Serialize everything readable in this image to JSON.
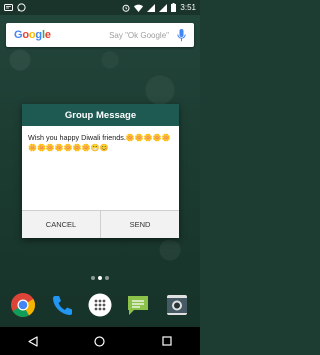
{
  "status_bar": {
    "time": "3:51",
    "left_icons": [
      "message-notification-icon",
      "whatsapp-notification-icon"
    ],
    "right_icons": [
      "alarm-icon",
      "wifi-icon",
      "signal-icon",
      "signal-icon",
      "battery-icon"
    ]
  },
  "search_widget": {
    "logo": [
      "G",
      "o",
      "o",
      "g",
      "l",
      "e"
    ],
    "hint": "Say \"Ok Google\"",
    "mic_icon": "mic-icon"
  },
  "dialog": {
    "title": "Group Message",
    "message": "Wish you happy Diwali friends.🌼🌼🌼🌼🌼🌼🌼🌼🌼🌼🌼🌼😁😊",
    "cancel_label": "CANCEL",
    "send_label": "SEND"
  },
  "page_dots": {
    "count": 3,
    "active_index": 1
  },
  "dock": {
    "apps": [
      "chrome-icon",
      "phone-icon",
      "app-drawer-icon",
      "messaging-icon",
      "camera-icon"
    ]
  },
  "nav_bar": {
    "buttons": [
      "back-icon",
      "home-icon",
      "recents-icon"
    ]
  },
  "colors": {
    "dialog_title_bg": "#1e5a52",
    "wallpaper": "#1d3d33",
    "mic": "#4285F4"
  }
}
